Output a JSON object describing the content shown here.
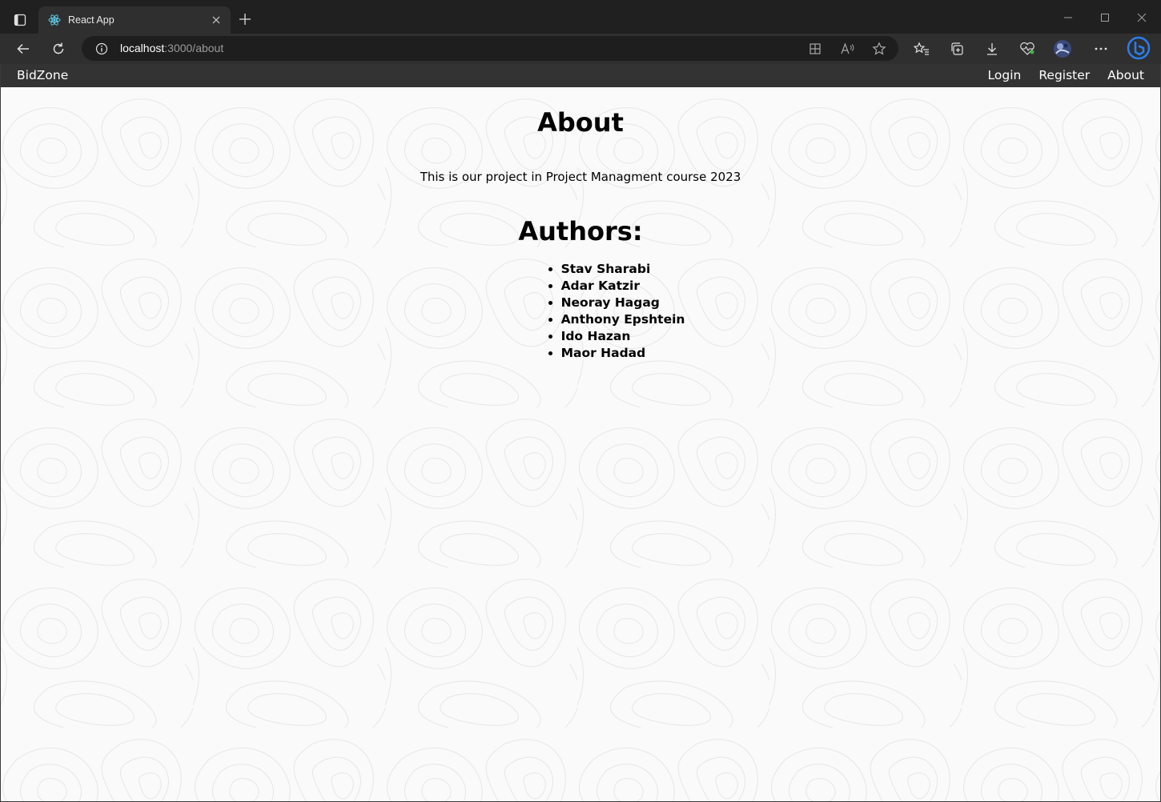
{
  "browser": {
    "tab_title": "React App",
    "url_host": "localhost",
    "url_path": ":3000/about"
  },
  "navbar": {
    "brand": "BidZone",
    "links": [
      "Login",
      "Register",
      "About"
    ]
  },
  "page": {
    "title": "About",
    "description": "This is our project in Project Managment course 2023",
    "authors_heading": "Authors:",
    "authors": [
      "Stav Sharabi",
      "Adar Katzir",
      "Neoray Hagag",
      "Anthony Epshtein",
      "Ido Hazan",
      "Maor Hadad"
    ]
  },
  "colors": {
    "navbar_bg": "#333333",
    "chrome_bg": "#202020",
    "toolbar_bg": "#2f2f2f",
    "page_bg": "#fafafa"
  }
}
